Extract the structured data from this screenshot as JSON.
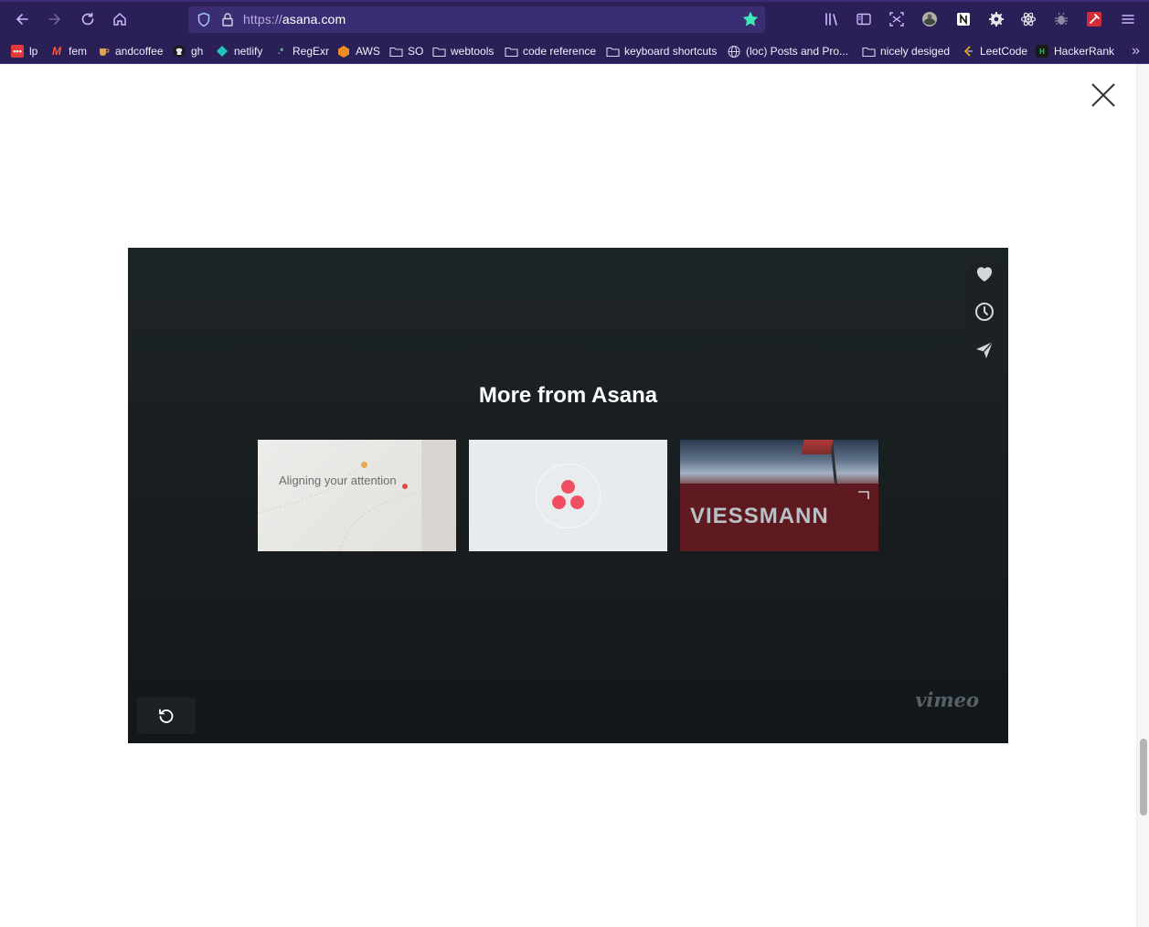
{
  "browser": {
    "url_scheme": "https://",
    "url_host": "asana.com",
    "nav": [
      "back-icon",
      "forward-icon",
      "reload-icon",
      "home-icon"
    ],
    "extensions": [
      "library-icon",
      "sidebar-icon",
      "screenshot-icon",
      "profile-avatar-icon",
      "notion-icon",
      "settings-gear-icon",
      "react-icon",
      "bug-icon",
      "color-picker-icon",
      "menu-icon"
    ],
    "bookmarks": [
      {
        "label": "lp",
        "icon": "lp-icon"
      },
      {
        "label": "fem",
        "icon": "fem-icon"
      },
      {
        "label": "andcoffee",
        "icon": "andcoffee-icon"
      },
      {
        "label": "gh",
        "icon": "github-icon"
      },
      {
        "label": "netlify",
        "icon": "netlify-icon"
      },
      {
        "label": "RegExr",
        "icon": "regexr-icon"
      },
      {
        "label": "AWS",
        "icon": "aws-icon"
      },
      {
        "label": "SO",
        "icon": "folder-icon"
      },
      {
        "label": "webtools",
        "icon": "folder-icon"
      },
      {
        "label": "code reference",
        "icon": "folder-icon"
      },
      {
        "label": "keyboard shortcuts",
        "icon": "folder-icon"
      },
      {
        "label": "(loc) Posts and Pro...",
        "icon": "globe-icon"
      },
      {
        "label": "nicely desiged",
        "icon": "folder-icon"
      },
      {
        "label": "LeetCode",
        "icon": "leetcode-icon"
      },
      {
        "label": "HackerRank",
        "icon": "hackerrank-icon"
      }
    ],
    "overflow_label": "»"
  },
  "player": {
    "title": "More from Asana",
    "videos": [
      {
        "thumb_text": "Aligning your attention"
      },
      {
        "thumb_text": ""
      },
      {
        "thumb_text": "VIESSMANN"
      }
    ],
    "brand": "vimeo"
  },
  "colors": {
    "chrome": "#2b1f57",
    "urlbar": "#3b2d73",
    "star": "#3ee8b5",
    "player_bg": "#1d2427",
    "asana_dot": "#ee4f62"
  }
}
